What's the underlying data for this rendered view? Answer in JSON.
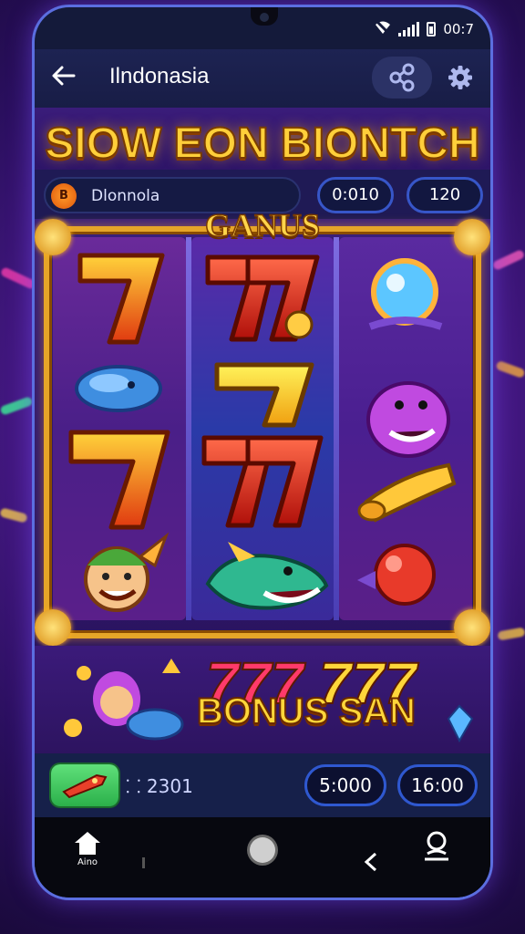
{
  "status": {
    "time": "00:7"
  },
  "appbar": {
    "title": "Ilndonasia"
  },
  "banner": {
    "title": "SIOW EON BIONTCH"
  },
  "info": {
    "username": "Dlonnola",
    "coin_glyph": "B",
    "value_1": "0:010",
    "value_2": "120"
  },
  "machine": {
    "header": "GANUS"
  },
  "reels": {
    "col1": [
      "seven",
      "whale-cap",
      "seven",
      "clown-face"
    ],
    "col2": [
      "seven-double",
      "seven-yellow",
      "seven-double",
      "shark-fish"
    ],
    "col3": [
      "crystal-orb",
      "purple-dragon",
      "golden-horn",
      "red-orb"
    ]
  },
  "bonus": {
    "label": "BONUS SAN",
    "left_777": "777",
    "right_777": "777"
  },
  "bottom": {
    "balance": "⸬ 2301",
    "bet": "5:000",
    "win": "16:00"
  },
  "nav": {
    "home_label": "Aino"
  },
  "colors": {
    "accent_gold": "#ffcf3a",
    "frame_gold": "#e6a528",
    "pill_blue": "#2f58d0",
    "spin_green": "#3bc85a"
  }
}
